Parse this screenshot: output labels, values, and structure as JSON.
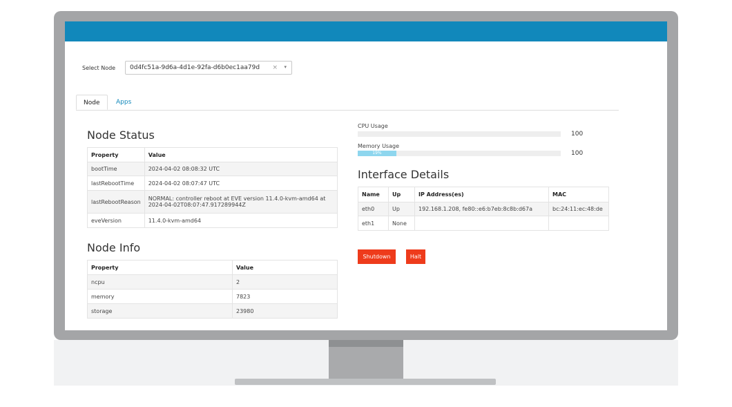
{
  "node_select": {
    "label": "Select Node",
    "value": "0d4fc51a-9d6a-4d1e-92fa-d6b0ec1aa79d",
    "clear_glyph": "×",
    "caret_glyph": "▾"
  },
  "tabs": [
    {
      "label": "Node"
    },
    {
      "label": "Apps"
    }
  ],
  "node_status": {
    "title": "Node Status",
    "headers": [
      "Property",
      "Value"
    ],
    "rows": [
      {
        "property": "bootTime",
        "value": "2024-04-02 08:08:32 UTC"
      },
      {
        "property": "lastRebootTime",
        "value": "2024-04-02 08:07:47 UTC"
      },
      {
        "property": "lastRebootReason",
        "value_line1": "NORMAL: controller reboot at EVE version 11.4.0-kvm-amd64 at",
        "value_line2": "2024-04-02T08:07:47.917289944Z"
      },
      {
        "property": "eveVersion",
        "value": "11.4.0-kvm-amd64"
      }
    ]
  },
  "node_info": {
    "title": "Node Info",
    "headers": [
      "Property",
      "Value"
    ],
    "rows": [
      {
        "property": "ncpu",
        "value": "2"
      },
      {
        "property": "memory",
        "value": "7823"
      },
      {
        "property": "storage",
        "value": "23980"
      }
    ]
  },
  "cpu_usage": {
    "label": "CPU Usage",
    "value": "100",
    "fill_fraction": 0
  },
  "memory_usage": {
    "label": "Memory Usage",
    "value": "100",
    "bar_text": "19%",
    "fill_fraction": 0.19
  },
  "interface_details": {
    "title": "Interface Details",
    "headers": [
      "Name",
      "Up",
      "IP Address(es)",
      "MAC"
    ],
    "rows": [
      {
        "name": "eth0",
        "up": "Up",
        "ip": "192.168.1.208, fe80::e6:b7eb:8c8b:d67a",
        "mac": "bc:24:11:ec:48:de"
      },
      {
        "name": "eth1",
        "up": "None",
        "ip": "",
        "mac": ""
      }
    ]
  },
  "actions": {
    "shutdown_label": "Shutdown",
    "halt_label": "Halt"
  },
  "colors": {
    "topbar": "#1188bb",
    "accent": "#1188bb",
    "danger": "#ee3b1b",
    "progress": "#8ed6ee"
  }
}
